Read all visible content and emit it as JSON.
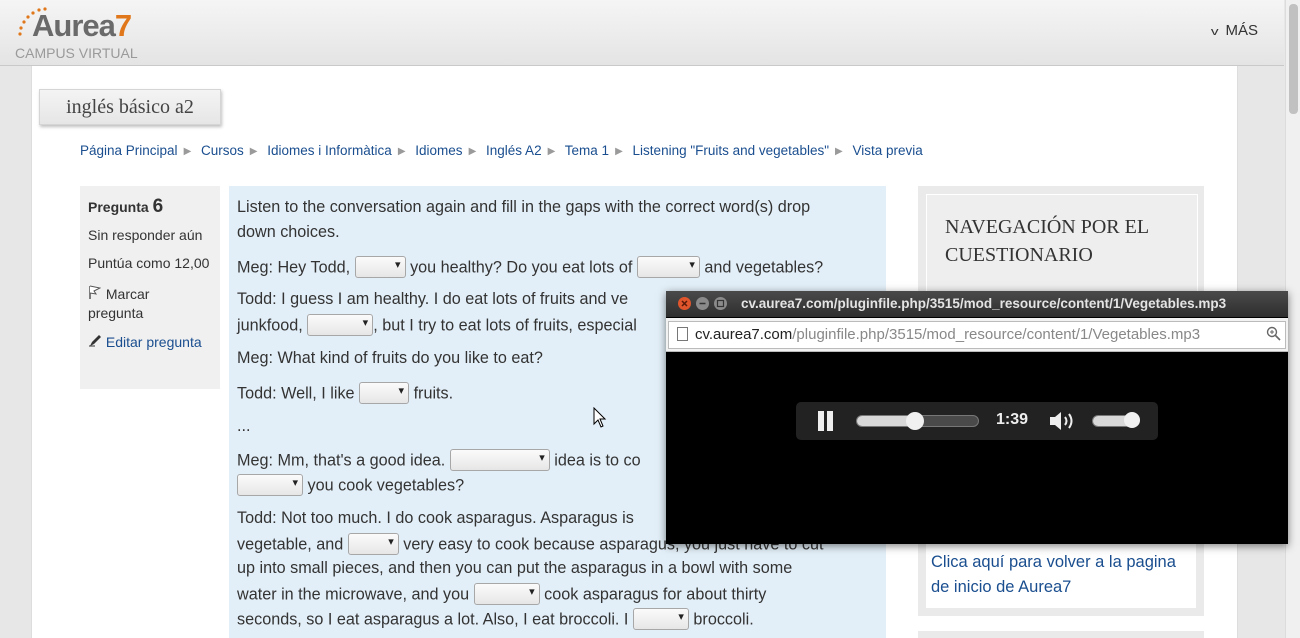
{
  "brand": {
    "name": "Aurea",
    "number": "7",
    "subtitle": "CAMPUS VIRTUAL"
  },
  "header": {
    "menu_label": "MÁS"
  },
  "course": {
    "title": "inglés básico a2"
  },
  "breadcrumb": [
    "Página Principal",
    "Cursos",
    "Idiomes i Informàtica",
    "Idiomes",
    "Inglés A2",
    "Tema 1",
    "Listening \"Fruits and vegetables\"",
    "Vista previa"
  ],
  "question": {
    "label": "Pregunta",
    "number": "6",
    "state": "Sin responder aún",
    "grade": "Puntúa como 12,00",
    "flag_label": "Marcar pregunta",
    "edit_label": "Editar pregunta"
  },
  "content": {
    "l1": "Listen to the conversation again and fill in the gaps with the correct word(s) drop",
    "l2": "down choices.",
    "l3a": "Meg: Hey Todd,",
    "l3b": "you healthy? Do you eat lots of",
    "l3c": "and vegetables?",
    "l4": "Todd: I guess I am healthy. I do eat lots of fruits and ve",
    "l5a": "junkfood,",
    "l5b": ", but I try to eat lots of fruits, especial",
    "l6": "Meg: What kind of fruits do you like to eat?",
    "l7a": "Todd: Well, I like",
    "l7b": "fruits.",
    "l8": "...",
    "l9a": "Meg: Mm, that's a good idea.",
    "l9b": "idea is to co",
    "l10": "you cook vegetables?",
    "l11": "Todd: Not too much. I do cook asparagus. Asparagus is",
    "l12a": "vegetable, and",
    "l12b": "very easy to cook because asparagus, you just have to cut",
    "l13": "up into small pieces, and then you can put the asparagus in a bowl with some",
    "l14a": "water in the microwave, and you",
    "l14b": "cook asparagus for about thirty",
    "l15a": "seconds, so I eat asparagus a lot. Also, I eat broccoli. I",
    "l15b": "broccoli."
  },
  "sidebar": {
    "nav_title": "NAVEGACIÓN POR EL CUESTIONARIO",
    "home_link": "Clica aquí para volver a la pagina de inicio de Aurea7"
  },
  "player": {
    "window_title": "cv.aurea7.com/pluginfile.php/3515/mod_resource/content/1/Vegetables.mp3",
    "url_domain": "cv.aurea7.com",
    "url_path": "/pluginfile.php/3515/mod_resource/content/1/Vegetables.mp3",
    "time": "1:39",
    "progress": 0.48,
    "volume": 0.85
  }
}
